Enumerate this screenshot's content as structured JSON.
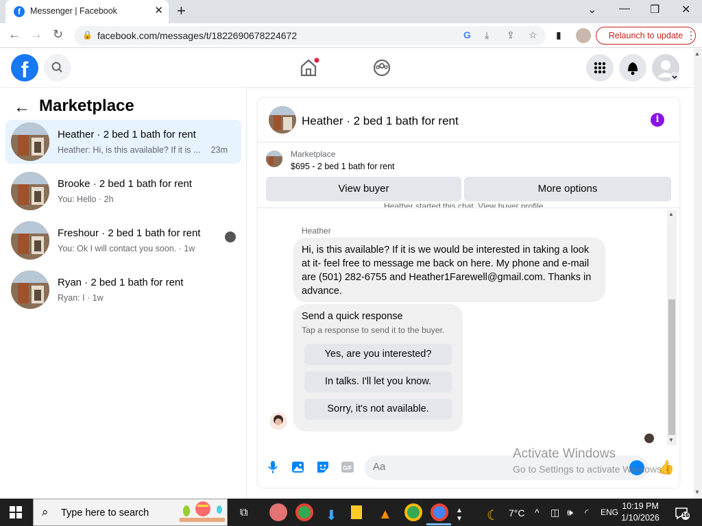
{
  "browser": {
    "tab_title": "Messenger | Facebook",
    "url": "facebook.com/messages/t/1822690678224672",
    "relaunch_label": "Relaunch to update"
  },
  "sidebar": {
    "title": "Marketplace",
    "conversations": [
      {
        "title": "Heather · 2 bed 1 bath for rent",
        "snippet": "Heather: Hi, is this available? If it is ...",
        "time": "23m",
        "active": true
      },
      {
        "title": "Brooke · 2 bed 1 bath for rent",
        "snippet": "You: Hello · 2h",
        "time": "",
        "active": false
      },
      {
        "title": "Freshour · 2 bed 1 bath for rent",
        "snippet": "You: Ok I will contact you soon. · 1w",
        "time": "",
        "active": false
      },
      {
        "title": "Ryan · 2 bed 1 bath for rent",
        "snippet": "Ryan: I · 1w",
        "time": "",
        "active": false
      }
    ]
  },
  "chat": {
    "title": "Heather · 2 bed 1 bath for rent",
    "marketplace_label": "Marketplace",
    "listing": "$695 - 2 bed 1 bath for rent",
    "view_buyer": "View buyer",
    "more_options": "More options",
    "started_text": "Heather started this chat. View buyer profile",
    "sender": "Heather",
    "message": "Hi, is this available?  If it is we would be interested in taking a look at it- feel free to message me back on here.  My phone and e-mail are (501) 282-6755 and Heather1Farewell@gmail.com. Thanks in advance.",
    "quick_title": "Send a quick response",
    "quick_sub": "Tap a response to send it to the buyer.",
    "quick_responses": [
      "Yes, are you interested?",
      "In talks. I'll let you know.",
      "Sorry, it's not available."
    ],
    "composer_placeholder": "Aa"
  },
  "watermark": {
    "line1": "Activate Windows",
    "line2": "Go to Settings to activate Windows."
  },
  "taskbar": {
    "search_placeholder": "Type here to search",
    "weather": "7°C",
    "lang": "ENG",
    "time": "10:19 PM",
    "date": "1/10/2026",
    "notifications": "16"
  },
  "colors": {
    "brand": "#1877f2",
    "messenger": "#0084ff",
    "info": "#8a12e8",
    "relaunch": "#c5221f"
  }
}
